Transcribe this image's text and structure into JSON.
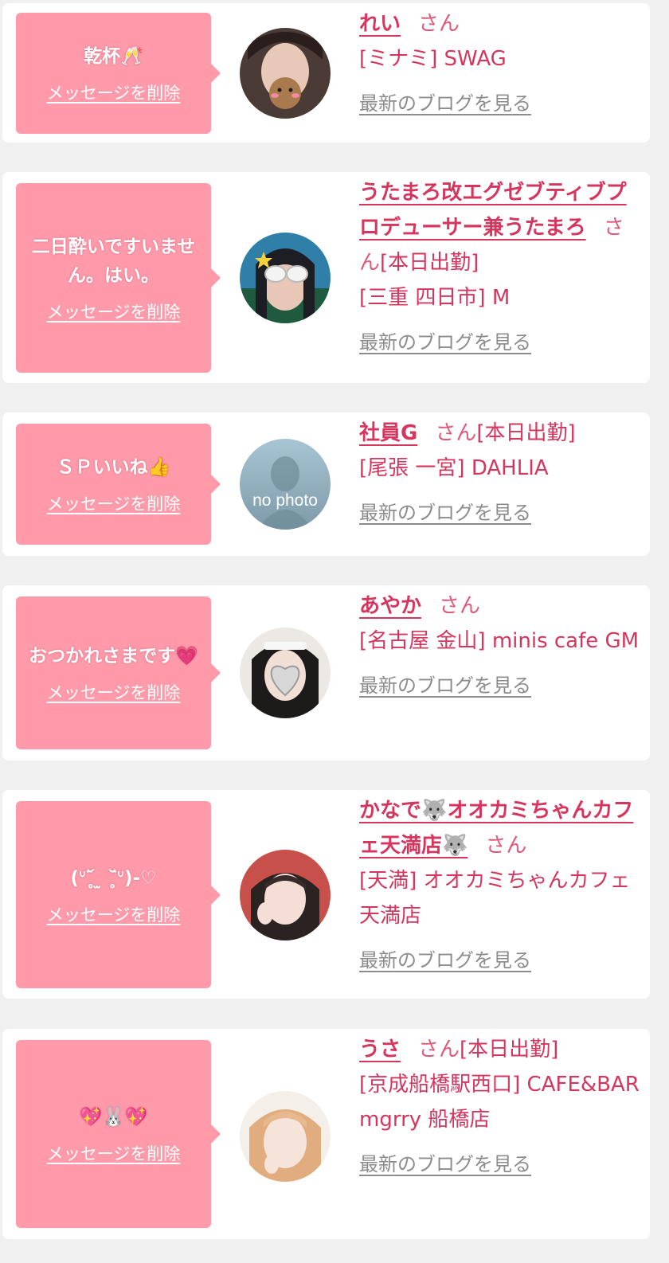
{
  "cards": [
    {
      "message": "乾杯🥂",
      "delete_label": "メッセージを削除",
      "name": "れい",
      "honorific": "さん",
      "status": "",
      "shop": "[ミナミ] SWAG",
      "blog_label": "最新のブログを見る",
      "avatar_color": "#4a3b36"
    },
    {
      "message": "二日酔いですいません。はい。",
      "delete_label": "メッセージを削除",
      "name": "うたまろ改エグゼブティブプロデューサー兼うたまろ",
      "honorific": "さん",
      "status": "[本日出勤]",
      "shop": "[三重 四日市] M",
      "blog_label": "最新のブログを見る",
      "avatar_color": "#2f7fa8"
    },
    {
      "message": "ＳＰいいね👍",
      "delete_label": "メッセージを削除",
      "name": "社員G",
      "honorific": "さん",
      "status": "[本日出勤]",
      "shop": "[尾張 一宮] DAHLIA",
      "blog_label": "最新のブログを見る",
      "avatar_color": "#8fb0c1",
      "avatar_text": "no photo"
    },
    {
      "message": "おつかれさまです💗",
      "delete_label": "メッセージを削除",
      "name": "あやか",
      "honorific": "さん",
      "status": "",
      "shop": "[名古屋 金山] minis cafe GM",
      "blog_label": "最新のブログを見る",
      "avatar_color": "#e9e4df"
    },
    {
      "message": "(ᐡ˘̥᷄ ̫ ˘̥᷅ᐡ)-♡",
      "delete_label": "メッセージを削除",
      "name": "かなで🐺オオカミちゃんカフェ天満店🐺",
      "honorific": "さん",
      "status": "",
      "shop": "[天満] オオカミちゃんカフェ天満店",
      "blog_label": "最新のブログを見る",
      "avatar_color": "#c8504a"
    },
    {
      "message": "💖🐰💖",
      "delete_label": "メッセージを削除",
      "name": "うさ",
      "honorific": "さん",
      "status": "[本日出勤]",
      "shop": "[京成船橋駅西口] CAFE&BAR mgrry 船橋店",
      "blog_label": "最新のブログを見る",
      "avatar_color": "#e6b48a"
    }
  ],
  "colors": {
    "bubble": "#ff9aab",
    "accent": "#d6365e",
    "link_gray": "#8c8c8c",
    "background": "#f0f0f0"
  }
}
